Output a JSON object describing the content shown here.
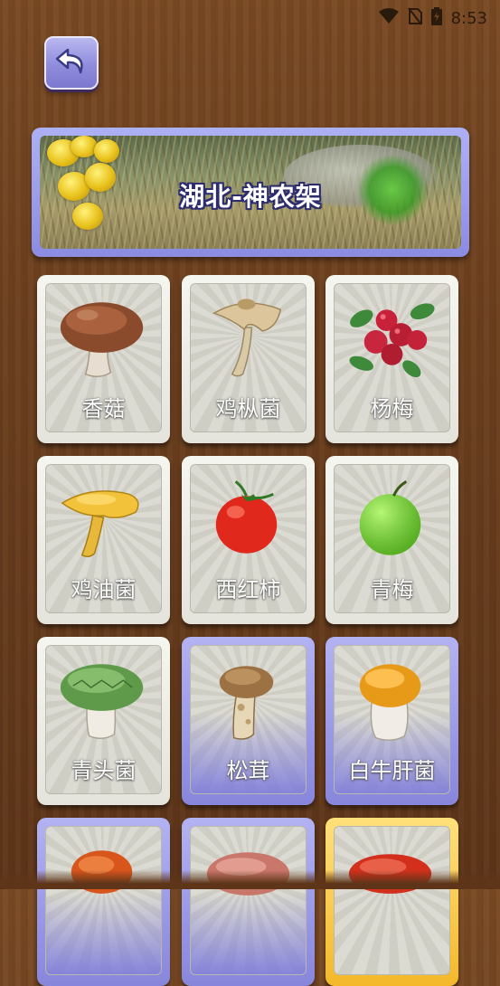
{
  "status_bar": {
    "time": "8:53",
    "icons": [
      "wifi-icon",
      "no-sim-icon",
      "battery-icon"
    ]
  },
  "header": {
    "back_icon": "back-arrow-icon"
  },
  "banner": {
    "title": "湖北-神农架"
  },
  "grid": {
    "items": [
      {
        "label": "香菇",
        "icon": "shiitake-mushroom-icon",
        "state": "normal"
      },
      {
        "label": "鸡枞菌",
        "icon": "termite-mushroom-icon",
        "state": "normal"
      },
      {
        "label": "杨梅",
        "icon": "bayberry-icon",
        "state": "normal"
      },
      {
        "label": "鸡油菌",
        "icon": "chanterelle-icon",
        "state": "normal"
      },
      {
        "label": "西红柿",
        "icon": "tomato-icon",
        "state": "normal"
      },
      {
        "label": "青梅",
        "icon": "green-plum-icon",
        "state": "normal"
      },
      {
        "label": "青头菌",
        "icon": "green-cap-mushroom-icon",
        "state": "normal"
      },
      {
        "label": "松茸",
        "icon": "matsutake-icon",
        "state": "selected"
      },
      {
        "label": "白牛肝菌",
        "icon": "porcini-icon",
        "state": "selected"
      },
      {
        "label": "",
        "icon": "orange-mushroom-icon",
        "state": "selected"
      },
      {
        "label": "",
        "icon": "pink-mushroom-icon",
        "state": "selected"
      },
      {
        "label": "",
        "icon": "red-mushroom-icon",
        "state": "gold"
      }
    ]
  }
}
